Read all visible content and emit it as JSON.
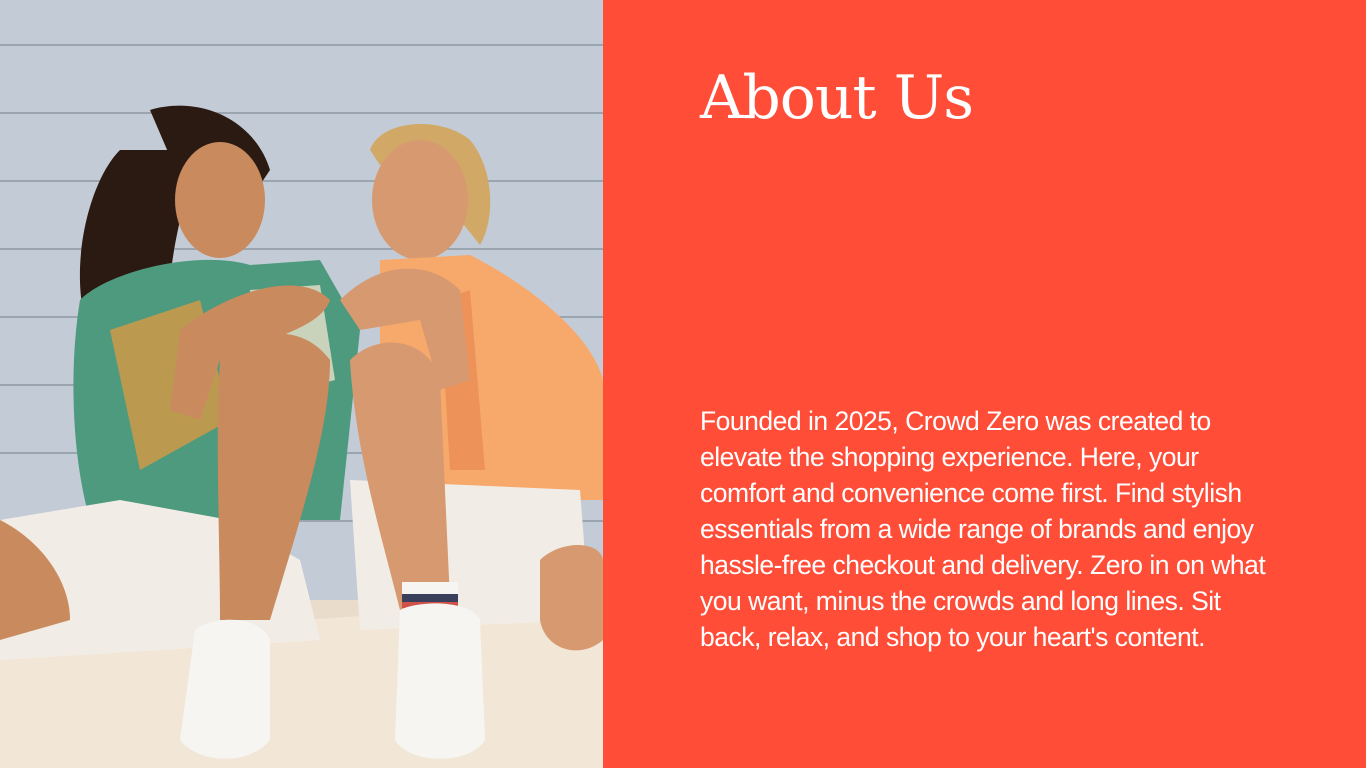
{
  "about": {
    "title": "About Us",
    "body": "Founded in 2025, Crowd Zero was created to elevate the shopping experience. Here, your comfort and convenience come first. Find stylish essentials from a wide range of brands and enjoy hassle-free checkout and delivery. Zero in on what you want, minus the crowds and long lines. Sit back, relax, and shop to your heart's content."
  },
  "colors": {
    "accent": "#ff4d38",
    "text": "#ffffff"
  }
}
